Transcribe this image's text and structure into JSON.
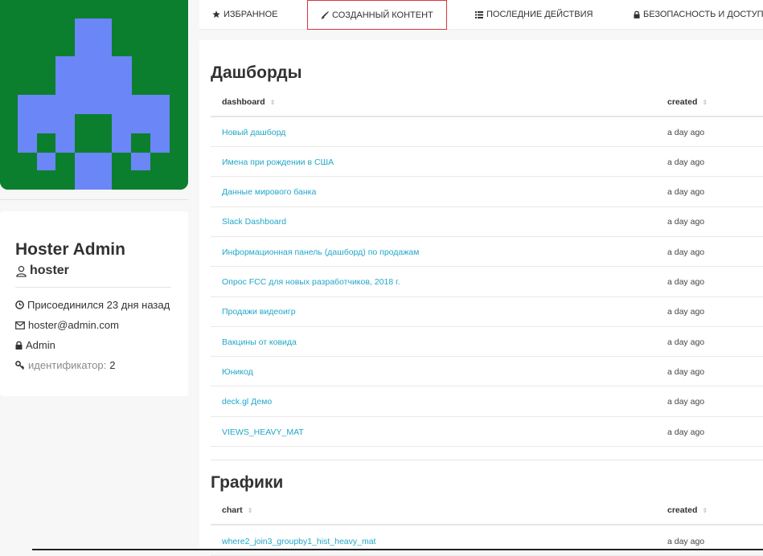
{
  "profile": {
    "name": "Hoster Admin",
    "login": "hoster",
    "joined": "Присоединился 23 дня назад",
    "email": "hoster@admin.com",
    "role": "Admin",
    "id_label": "идентификатор:",
    "id_value": "2",
    "avatar_colors": {
      "bg": "#0b7f2e",
      "fg": "#6b86f7"
    }
  },
  "tabs": [
    {
      "label": "ИЗБРАННОЕ",
      "icon": "star-icon"
    },
    {
      "label": "СОЗДАННЫЙ КОНТЕНТ",
      "icon": "brush-icon",
      "active": true
    },
    {
      "label": "ПОСЛЕДНИЕ ДЕЙСТВИЯ",
      "icon": "list-icon"
    },
    {
      "label": "БЕЗОПАСНОСТЬ И ДОСТУП",
      "icon": "lock-icon"
    }
  ],
  "dashboards": {
    "title": "Дашборды",
    "col_name": "dashboard",
    "col_created": "created",
    "rows": [
      {
        "name": "Новый дашборд",
        "created": "a day ago"
      },
      {
        "name": "Имена при рождении в США",
        "created": "a day ago"
      },
      {
        "name": "Данные мирового банка",
        "created": "a day ago"
      },
      {
        "name": "Slack Dashboard",
        "created": "a day ago"
      },
      {
        "name": "Информационная панель (дашборд) по продажам",
        "created": "a day ago"
      },
      {
        "name": "Опрос FCC для новых разработчиков, 2018 г.",
        "created": "a day ago"
      },
      {
        "name": "Продажи видеоигр",
        "created": "a day ago"
      },
      {
        "name": "Вакцины от ковида",
        "created": "a day ago"
      },
      {
        "name": "Юникод",
        "created": "a day ago"
      },
      {
        "name": "deck.gl Демо",
        "created": "a day ago"
      },
      {
        "name": "VIEWS_HEAVY_MAT",
        "created": "a day ago"
      }
    ]
  },
  "charts": {
    "title": "Графики",
    "col_name": "chart",
    "col_created": "created",
    "rows": [
      {
        "name": "where2_join3_groupby1_hist_heavy_mat",
        "created": "a day ago"
      }
    ]
  },
  "colors": {
    "link": "#20a7c9",
    "active_tab_border": "#d9363e"
  }
}
